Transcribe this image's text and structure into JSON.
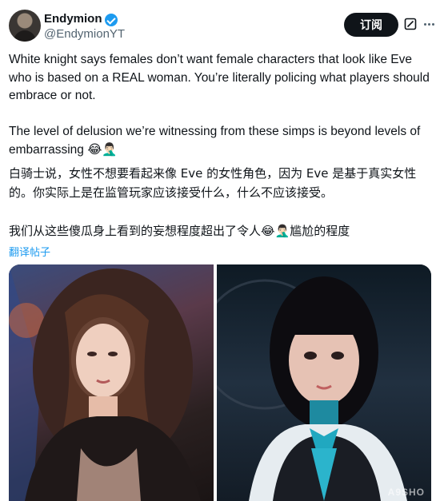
{
  "author": {
    "display_name": "Endymion",
    "handle": "@EndymionYT",
    "verified": true,
    "avatar_icon": "user-avatar"
  },
  "actions": {
    "subscribe_label": "订阅",
    "grok_icon": "grok-icon",
    "more_icon": "more-dots-icon"
  },
  "post": {
    "text_en": "White knight says females don’t want female characters that look like Eve who is based on a REAL woman. You’re literally policing what players should embrace or not.\n\nThe level of delusion we’re witnessing from these simps is beyond levels of embarrassing 😂🤦🏻‍♂️",
    "text_zh": "白骑士说，女性不想要看起来像 Eve 的女性角色，因为 Eve 是基于真实女性的。你实际上是在监管玩家应该接受什么，什么不应该接受。\n\n我们从这些傻瓜身上看到的妄想程度超出了令人😂🤦🏻‍♂️尴尬的程度",
    "translate_label": "翻译帖子"
  },
  "media": {
    "images": [
      "photo-real-woman",
      "photo-game-character-eve"
    ],
    "watermark": "A9SHO"
  },
  "colors": {
    "accent": "#1d9bf0",
    "text": "#0f1419",
    "secondary": "#536471",
    "button_bg": "#0f1419"
  }
}
